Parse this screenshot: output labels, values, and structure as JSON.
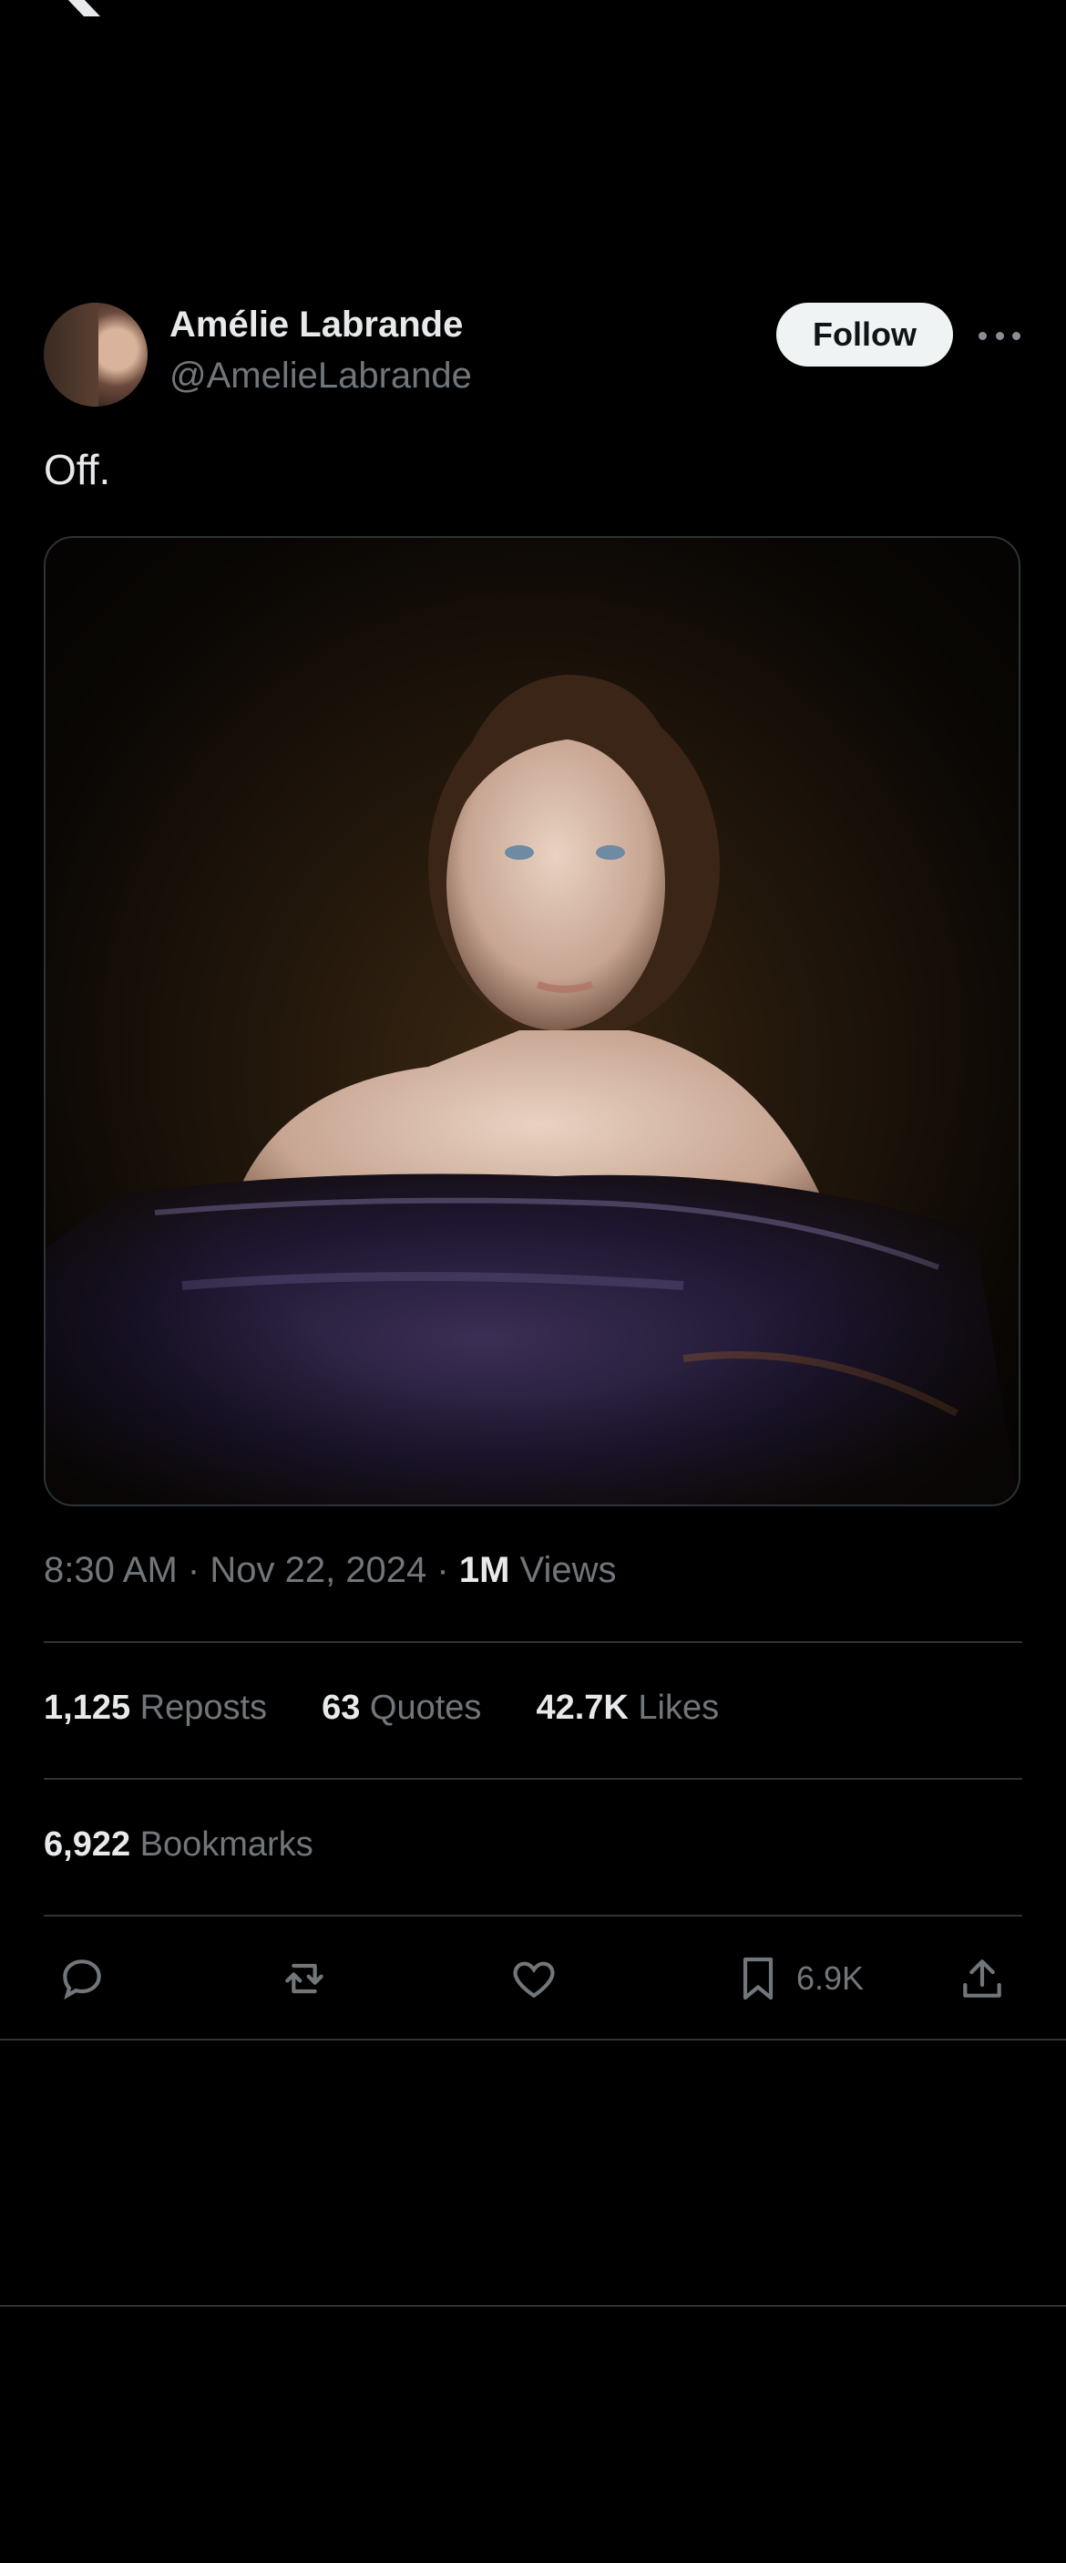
{
  "header": {
    "logo_icon": "x-logo-icon"
  },
  "author": {
    "name": "Amélie Labrande",
    "handle": "@AmelieLabrande",
    "follow_label": "Follow"
  },
  "tweet": {
    "text": "Off.",
    "time": "8:30 AM",
    "date": "Nov 22, 2024",
    "views_count": "1M",
    "views_label": "Views"
  },
  "stats": {
    "reposts_count": "1,125",
    "reposts_label": "Reposts",
    "quotes_count": "63",
    "quotes_label": "Quotes",
    "likes_count": "42.7K",
    "likes_label": "Likes",
    "bookmarks_count": "6,922",
    "bookmarks_label": "Bookmarks"
  },
  "actions": {
    "reply_icon": "reply-icon",
    "repost_icon": "repost-icon",
    "like_icon": "heart-icon",
    "bookmark_icon": "bookmark-icon",
    "bookmark_count": "6.9K",
    "share_icon": "share-icon"
  },
  "colors": {
    "background": "#000000",
    "text": "#e7e9ea",
    "muted": "#71767b",
    "divider": "#2f3336",
    "follow_bg": "#eff3f4"
  }
}
